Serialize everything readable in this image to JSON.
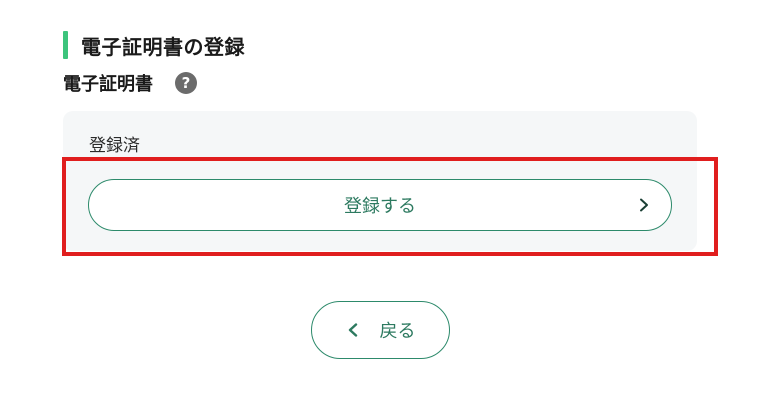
{
  "section": {
    "title": "電子証明書の登録",
    "accent_color": "#3cc47c"
  },
  "field": {
    "label": "電子証明書",
    "help_icon": "help-circle-icon",
    "help_glyph": "?"
  },
  "card": {
    "status": "登録済"
  },
  "register_button": {
    "label": "登録する",
    "icon": "chevron-right-icon",
    "highlighted": true,
    "highlight_color": "#e01e1e"
  },
  "back_button": {
    "label": "戻る",
    "icon": "chevron-left-icon"
  },
  "colors": {
    "brand_green": "#2d8a6b",
    "card_bg": "#f5f7f8"
  }
}
